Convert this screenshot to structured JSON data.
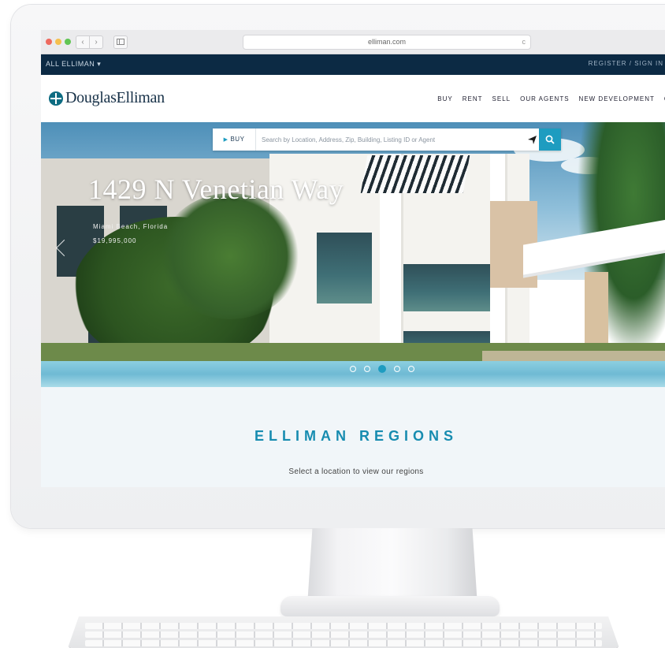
{
  "browser": {
    "url": "elliman.com",
    "back_symbol": "‹",
    "forward_symbol": "›",
    "reload_symbol": "c"
  },
  "utility_bar": {
    "left_text": "ALL ELLIMAN ▾",
    "right_text": "REGISTER / SIGN IN"
  },
  "header": {
    "logo_text": "DouglasElliman",
    "nav": [
      "BUY",
      "RENT",
      "SELL",
      "OUR AGENTS",
      "NEW DEVELOPMENT",
      "OF"
    ]
  },
  "hero": {
    "title": "1429 N Venetian Way",
    "subtitle_line1": "Miami Beach, Florida",
    "subtitle_line2": "$19,995,000",
    "slides_total": 5,
    "active_slide": 3
  },
  "search": {
    "type_label": "BUY",
    "placeholder": "Search by Location, Address, Zip, Building, Listing ID or Agent"
  },
  "regions": {
    "title": "ELLIMAN REGIONS",
    "subtitle": "Select a location to view our regions"
  },
  "colors": {
    "navy": "#0c2a44",
    "accent": "#1e9cc0",
    "regions_title": "#178cb0"
  },
  "icons": {
    "search": "magnifier",
    "locate": "location-arrow",
    "logo": "elliman-rosette"
  }
}
